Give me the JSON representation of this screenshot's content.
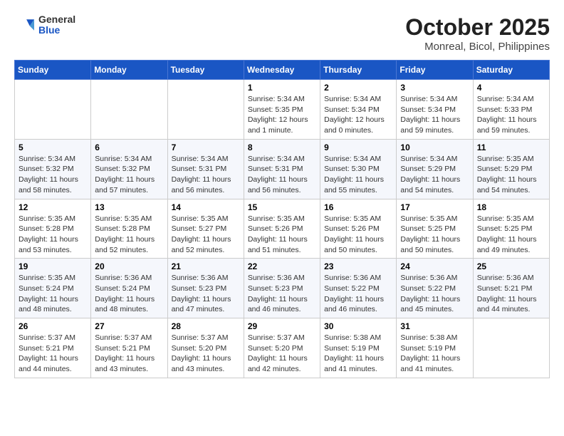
{
  "header": {
    "logo_general": "General",
    "logo_blue": "Blue",
    "month_title": "October 2025",
    "location": "Monreal, Bicol, Philippines"
  },
  "days_of_week": [
    "Sunday",
    "Monday",
    "Tuesday",
    "Wednesday",
    "Thursday",
    "Friday",
    "Saturday"
  ],
  "weeks": [
    [
      {
        "day": "",
        "detail": ""
      },
      {
        "day": "",
        "detail": ""
      },
      {
        "day": "",
        "detail": ""
      },
      {
        "day": "1",
        "detail": "Sunrise: 5:34 AM\nSunset: 5:35 PM\nDaylight: 12 hours\nand 1 minute."
      },
      {
        "day": "2",
        "detail": "Sunrise: 5:34 AM\nSunset: 5:34 PM\nDaylight: 12 hours\nand 0 minutes."
      },
      {
        "day": "3",
        "detail": "Sunrise: 5:34 AM\nSunset: 5:34 PM\nDaylight: 11 hours\nand 59 minutes."
      },
      {
        "day": "4",
        "detail": "Sunrise: 5:34 AM\nSunset: 5:33 PM\nDaylight: 11 hours\nand 59 minutes."
      }
    ],
    [
      {
        "day": "5",
        "detail": "Sunrise: 5:34 AM\nSunset: 5:32 PM\nDaylight: 11 hours\nand 58 minutes."
      },
      {
        "day": "6",
        "detail": "Sunrise: 5:34 AM\nSunset: 5:32 PM\nDaylight: 11 hours\nand 57 minutes."
      },
      {
        "day": "7",
        "detail": "Sunrise: 5:34 AM\nSunset: 5:31 PM\nDaylight: 11 hours\nand 56 minutes."
      },
      {
        "day": "8",
        "detail": "Sunrise: 5:34 AM\nSunset: 5:31 PM\nDaylight: 11 hours\nand 56 minutes."
      },
      {
        "day": "9",
        "detail": "Sunrise: 5:34 AM\nSunset: 5:30 PM\nDaylight: 11 hours\nand 55 minutes."
      },
      {
        "day": "10",
        "detail": "Sunrise: 5:34 AM\nSunset: 5:29 PM\nDaylight: 11 hours\nand 54 minutes."
      },
      {
        "day": "11",
        "detail": "Sunrise: 5:35 AM\nSunset: 5:29 PM\nDaylight: 11 hours\nand 54 minutes."
      }
    ],
    [
      {
        "day": "12",
        "detail": "Sunrise: 5:35 AM\nSunset: 5:28 PM\nDaylight: 11 hours\nand 53 minutes."
      },
      {
        "day": "13",
        "detail": "Sunrise: 5:35 AM\nSunset: 5:28 PM\nDaylight: 11 hours\nand 52 minutes."
      },
      {
        "day": "14",
        "detail": "Sunrise: 5:35 AM\nSunset: 5:27 PM\nDaylight: 11 hours\nand 52 minutes."
      },
      {
        "day": "15",
        "detail": "Sunrise: 5:35 AM\nSunset: 5:26 PM\nDaylight: 11 hours\nand 51 minutes."
      },
      {
        "day": "16",
        "detail": "Sunrise: 5:35 AM\nSunset: 5:26 PM\nDaylight: 11 hours\nand 50 minutes."
      },
      {
        "day": "17",
        "detail": "Sunrise: 5:35 AM\nSunset: 5:25 PM\nDaylight: 11 hours\nand 50 minutes."
      },
      {
        "day": "18",
        "detail": "Sunrise: 5:35 AM\nSunset: 5:25 PM\nDaylight: 11 hours\nand 49 minutes."
      }
    ],
    [
      {
        "day": "19",
        "detail": "Sunrise: 5:35 AM\nSunset: 5:24 PM\nDaylight: 11 hours\nand 48 minutes."
      },
      {
        "day": "20",
        "detail": "Sunrise: 5:36 AM\nSunset: 5:24 PM\nDaylight: 11 hours\nand 48 minutes."
      },
      {
        "day": "21",
        "detail": "Sunrise: 5:36 AM\nSunset: 5:23 PM\nDaylight: 11 hours\nand 47 minutes."
      },
      {
        "day": "22",
        "detail": "Sunrise: 5:36 AM\nSunset: 5:23 PM\nDaylight: 11 hours\nand 46 minutes."
      },
      {
        "day": "23",
        "detail": "Sunrise: 5:36 AM\nSunset: 5:22 PM\nDaylight: 11 hours\nand 46 minutes."
      },
      {
        "day": "24",
        "detail": "Sunrise: 5:36 AM\nSunset: 5:22 PM\nDaylight: 11 hours\nand 45 minutes."
      },
      {
        "day": "25",
        "detail": "Sunrise: 5:36 AM\nSunset: 5:21 PM\nDaylight: 11 hours\nand 44 minutes."
      }
    ],
    [
      {
        "day": "26",
        "detail": "Sunrise: 5:37 AM\nSunset: 5:21 PM\nDaylight: 11 hours\nand 44 minutes."
      },
      {
        "day": "27",
        "detail": "Sunrise: 5:37 AM\nSunset: 5:21 PM\nDaylight: 11 hours\nand 43 minutes."
      },
      {
        "day": "28",
        "detail": "Sunrise: 5:37 AM\nSunset: 5:20 PM\nDaylight: 11 hours\nand 43 minutes."
      },
      {
        "day": "29",
        "detail": "Sunrise: 5:37 AM\nSunset: 5:20 PM\nDaylight: 11 hours\nand 42 minutes."
      },
      {
        "day": "30",
        "detail": "Sunrise: 5:38 AM\nSunset: 5:19 PM\nDaylight: 11 hours\nand 41 minutes."
      },
      {
        "day": "31",
        "detail": "Sunrise: 5:38 AM\nSunset: 5:19 PM\nDaylight: 11 hours\nand 41 minutes."
      },
      {
        "day": "",
        "detail": ""
      }
    ]
  ]
}
